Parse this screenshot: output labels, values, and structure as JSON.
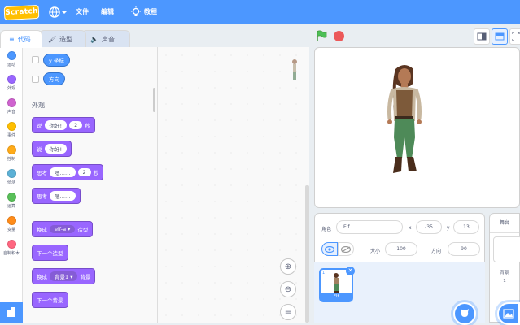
{
  "menubar": {
    "logo_text": "Scratch",
    "file_label": "文件",
    "edit_label": "编辑",
    "tutorials_label": "教程"
  },
  "tabs": {
    "code": "代码",
    "costumes": "造型",
    "sounds": "声音"
  },
  "categories": [
    {
      "label": "运动",
      "color": "#4c97ff"
    },
    {
      "label": "外观",
      "color": "#9966ff"
    },
    {
      "label": "声音",
      "color": "#cf63cf"
    },
    {
      "label": "事件",
      "color": "#ffbf00"
    },
    {
      "label": "控制",
      "color": "#ffab19"
    },
    {
      "label": "侦测",
      "color": "#5cb1d6"
    },
    {
      "label": "运算",
      "color": "#59c059"
    },
    {
      "label": "变量",
      "color": "#ff8c1a"
    },
    {
      "label": "自制积木",
      "color": "#ff6680"
    }
  ],
  "palette": {
    "motion_reporters": [
      "y 坐标",
      "方向"
    ],
    "section_title": "外观",
    "say_for": {
      "verb": "说",
      "text": "你好!",
      "secs": "2",
      "unit": "秒"
    },
    "say": {
      "verb": "说",
      "text": "你好!"
    },
    "think_for": {
      "verb": "思考",
      "text": "嗯……",
      "secs": "2",
      "unit": "秒"
    },
    "think": {
      "verb": "思考",
      "text": "嗯……"
    },
    "switch_costume": {
      "verb": "换成",
      "value": "elf-a",
      "suffix": "造型"
    },
    "next_costume": "下一个造型",
    "switch_backdrop": {
      "verb": "换成",
      "value": "背景1",
      "suffix": "背景"
    },
    "next_backdrop": "下一个背景"
  },
  "sprite_info": {
    "sprite_label": "角色",
    "sprite_name": "Elf",
    "x_label": "x",
    "x_value": "-35",
    "y_label": "y",
    "y_value": "13",
    "show_label": "显示",
    "size_label": "大小",
    "size_value": "100",
    "direction_label": "方向",
    "direction_value": "90"
  },
  "sprites": [
    {
      "name": "Elf",
      "number": "1"
    }
  ],
  "stage_pane": {
    "title": "舞台",
    "backdrops_label": "背景",
    "backdrops_count": "1"
  },
  "colors": {
    "accent": "#4c97ff",
    "looks": "#9966ff",
    "flag": "#0fbd8c",
    "stop": "#ec5959"
  }
}
